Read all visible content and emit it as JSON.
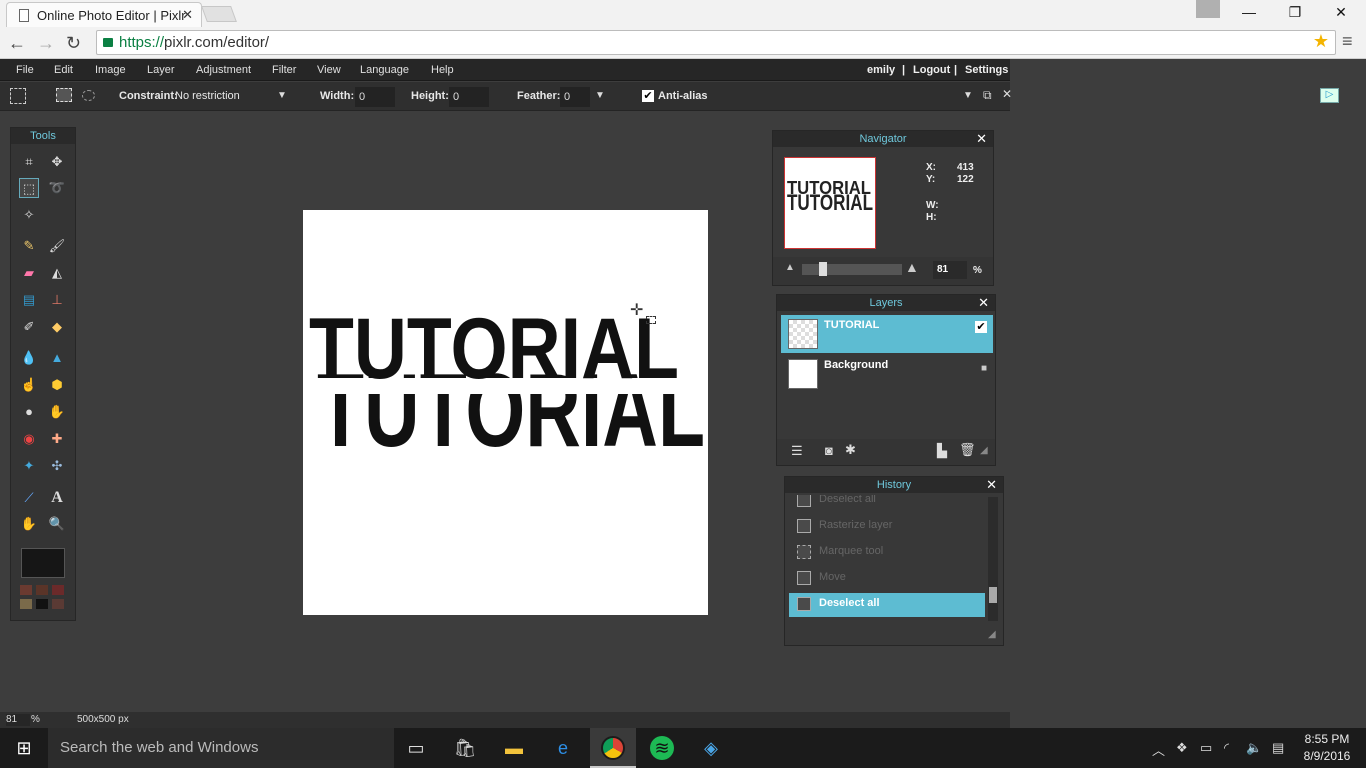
{
  "browser": {
    "tab_title": "Online Photo Editor | Pixlr",
    "url_scheme": "https://",
    "url_rest": "pixlr.com/editor/"
  },
  "menu": {
    "items": [
      "File",
      "Edit",
      "Image",
      "Layer",
      "Adjustment",
      "Filter",
      "View",
      "Language",
      "Help"
    ],
    "user": "emily",
    "sep1": "|",
    "logout": "Logout",
    "sep2": "|",
    "settings": "Settings"
  },
  "options": {
    "constraint_label": "Constraint:",
    "constraint_value": "No restriction",
    "width_label": "Width:",
    "width_value": "0",
    "height_label": "Height:",
    "height_value": "0",
    "feather_label": "Feather:",
    "feather_value": "0",
    "antialias_label": "Anti-alias",
    "antialias_checked": true
  },
  "tools": {
    "title": "Tools"
  },
  "canvas": {
    "text": "TUTORIAL"
  },
  "navigator": {
    "title": "Navigator",
    "x_label": "X:",
    "x_value": "413",
    "y_label": "Y:",
    "y_value": "122",
    "w_label": "W:",
    "h_label": "H:",
    "zoom_value": "81",
    "zoom_unit": "%"
  },
  "layers": {
    "title": "Layers",
    "items": [
      {
        "name": "TUTORIAL",
        "selected": true,
        "visible": true
      },
      {
        "name": "Background",
        "selected": false,
        "locked": true
      }
    ]
  },
  "history": {
    "title": "History",
    "items": [
      "Deselect all",
      "Rasterize layer",
      "Marquee tool",
      "Move",
      "Deselect all"
    ],
    "selected_index": 4
  },
  "status": {
    "zoom": "81",
    "zoom_unit": "%",
    "size": "500x500 px"
  },
  "taskbar": {
    "search_placeholder": "Search the web and Windows",
    "time": "8:55 PM",
    "date": "8/9/2016"
  }
}
